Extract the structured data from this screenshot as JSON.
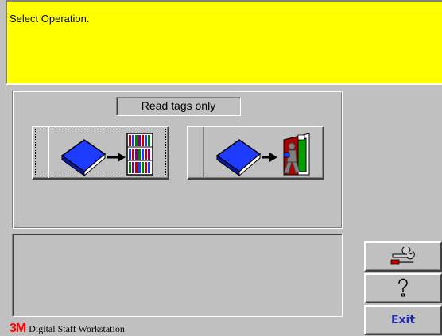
{
  "prompt": {
    "text": "Select Operation."
  },
  "operations": {
    "mode_label": "Read tags only",
    "buttons": [
      {
        "icon": "book-to-shelf-icon",
        "selected": true
      },
      {
        "icon": "book-person-exit-door-icon",
        "selected": false
      }
    ]
  },
  "message_panel": {
    "text": ""
  },
  "side_buttons": {
    "tools_icon": "tools-wrench-screwdriver-icon",
    "help_icon": "question-mark-icon",
    "exit_label": "Exit"
  },
  "branding": {
    "logo_text": "3M",
    "app_name": "Digital Staff Workstation"
  },
  "colors": {
    "prompt_background": "#ffff00",
    "window_background": "#c0c0c0",
    "exit_text": "#1f2bb0",
    "logo_red": "#ff0000",
    "book_blue": "#1e3cff"
  }
}
